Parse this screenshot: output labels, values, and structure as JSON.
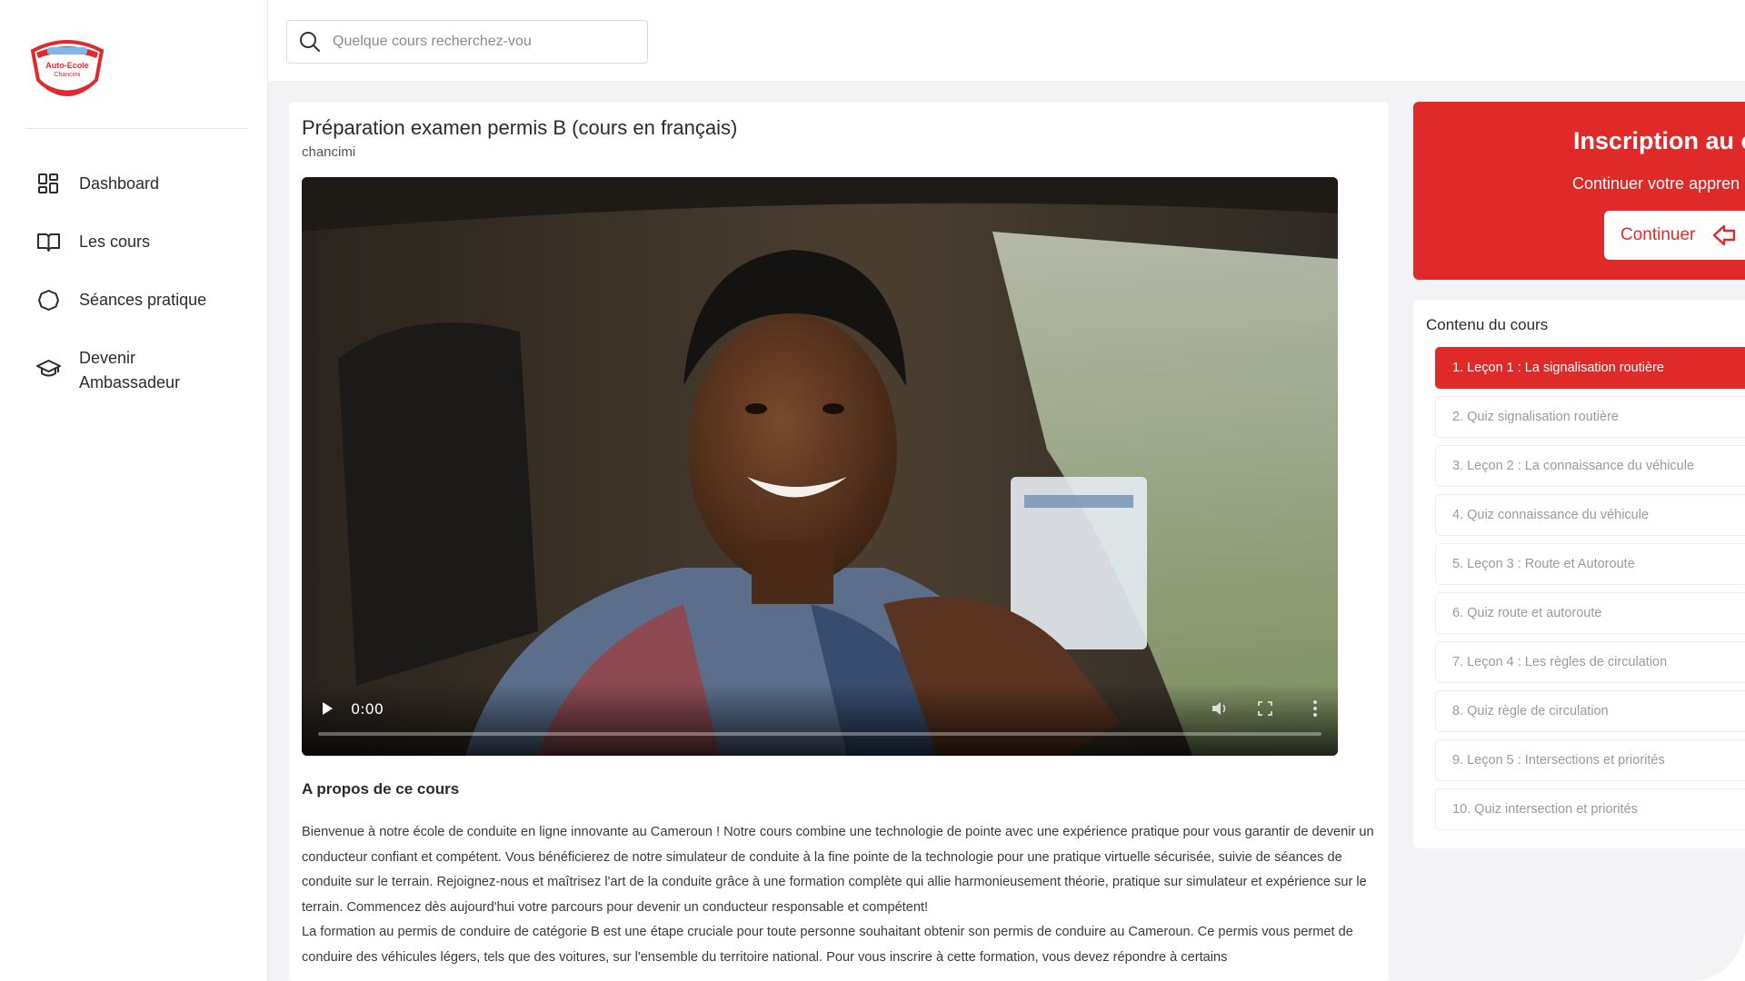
{
  "sidebar": {
    "logo_text": "Auto-Ecole Chancimi",
    "items": [
      {
        "label": "Dashboard",
        "icon": "dashboard-icon"
      },
      {
        "label": "Les cours",
        "icon": "book-icon"
      },
      {
        "label": "Séances pratique",
        "icon": "circle-icon"
      },
      {
        "label": "Devenir Ambassadeur",
        "icon": "graduation-cap-icon"
      }
    ]
  },
  "search": {
    "placeholder": "Quelque cours recherchez-vou"
  },
  "course": {
    "title": "Préparation examen permis B (cours en français)",
    "author": "chancimi",
    "video": {
      "time": "0:00",
      "progress": 0
    },
    "about_title": "A propos de ce cours",
    "about_paragraphs": [
      "Bienvenue à notre école de conduite en ligne innovante au Cameroun ! Notre cours combine une technologie de pointe avec une expérience pratique pour vous garantir de devenir un conducteur confiant et compétent. Vous bénéficierez de notre simulateur de conduite à la fine pointe de la technologie pour une pratique virtuelle sécurisée, suivie de séances de conduite sur le terrain. Rejoignez-nous et maîtrisez l'art de la conduite grâce à une formation complète qui allie harmonieusement théorie, pratique sur simulateur et expérience sur le terrain. Commencez dès aujourd'hui votre parcours pour devenir un conducteur responsable et compétent!",
      "La formation au permis de conduire de catégorie B est une étape cruciale pour toute personne souhaitant obtenir son permis de conduire au Cameroun. Ce permis vous permet de conduire des véhicules légers, tels que des voitures, sur l'ensemble du territoire national. Pour vous inscrire à cette formation, vous devez répondre à certains"
    ]
  },
  "enroll": {
    "title": "Inscription au c",
    "subtitle": "Continuer votre appren",
    "button_label": "Continuer"
  },
  "content": {
    "title": "Contenu du cours",
    "lessons": [
      {
        "label": "1. Leçon 1 : La signalisation routière",
        "active": true
      },
      {
        "label": "2. Quiz signalisation routière",
        "active": false
      },
      {
        "label": "3. Leçon 2 : La connaissance du véhicule",
        "active": false
      },
      {
        "label": "4. Quiz connaissance du véhicule",
        "active": false
      },
      {
        "label": "5. Leçon 3 : Route et Autoroute",
        "active": false
      },
      {
        "label": "6. Quiz route et autoroute",
        "active": false
      },
      {
        "label": "7. Leçon 4 : Les règles de circulation",
        "active": false
      },
      {
        "label": "8. Quiz règle de circulation",
        "active": false
      },
      {
        "label": "9. Leçon 5 : Intersections et priorités",
        "active": false
      },
      {
        "label": "10. Quiz intersection et priorités",
        "active": false
      }
    ]
  },
  "colors": {
    "accent": "#e02a2a",
    "background": "#f3f3f5"
  }
}
